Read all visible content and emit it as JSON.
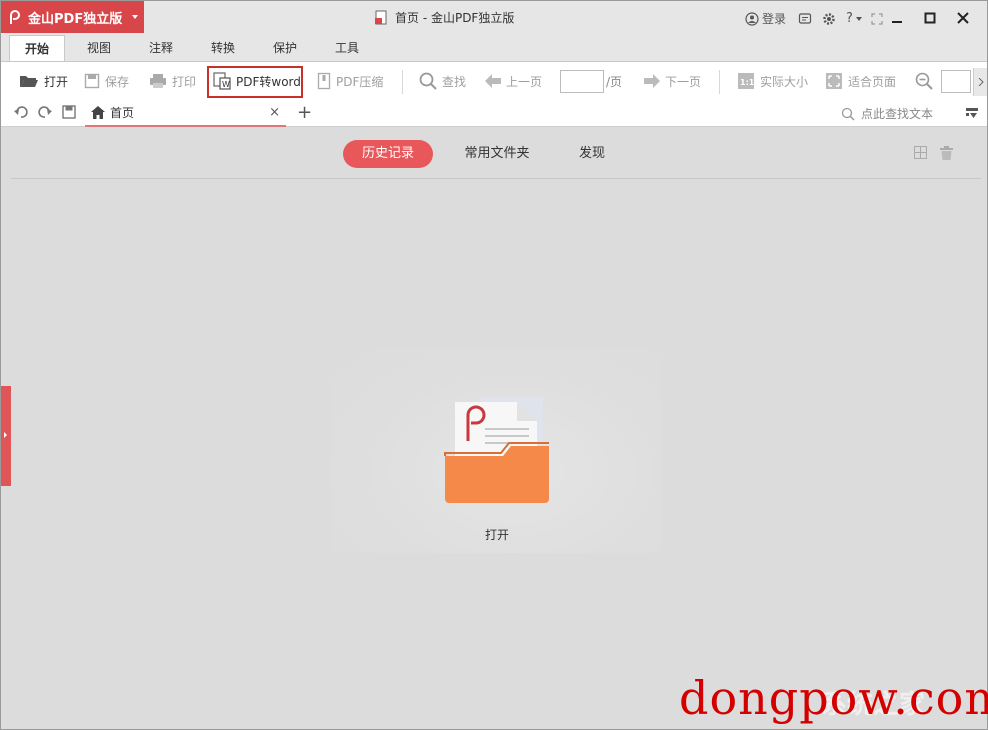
{
  "app": {
    "brand_name": "金山PDF独立版",
    "window_title": "首页 - 金山PDF独立版"
  },
  "title_tools": {
    "login_label": "登录",
    "help_label": "?"
  },
  "ribbon_tabs": [
    {
      "label": "开始",
      "active": true
    },
    {
      "label": "视图"
    },
    {
      "label": "注释"
    },
    {
      "label": "转换"
    },
    {
      "label": "保护"
    },
    {
      "label": "工具"
    }
  ],
  "toolbar": {
    "open": "打开",
    "save": "保存",
    "print": "打印",
    "pdf_to_word": "PDF转word",
    "pdf_compress": "PDF压缩",
    "find": "查找",
    "prev_page": "上一页",
    "page_suffix": "/页",
    "next_page": "下一页",
    "actual_size": "实际大小",
    "fit_page": "适合页面"
  },
  "doc_tabs": [
    {
      "label": "首页"
    }
  ],
  "search": {
    "placeholder": "点此查找文本"
  },
  "home": {
    "tabs": [
      {
        "label": "历史记录",
        "active": true
      },
      {
        "label": "常用文件夹"
      },
      {
        "label": "发现"
      }
    ],
    "open_label": "打开"
  },
  "watermark": {
    "text": "dongpow.com",
    "overlay": "系统之家"
  },
  "colors": {
    "brand": "#d9464a",
    "active_pill": "#e8585b",
    "highlight_box": "#c9302c",
    "folder": "#f4894a"
  }
}
